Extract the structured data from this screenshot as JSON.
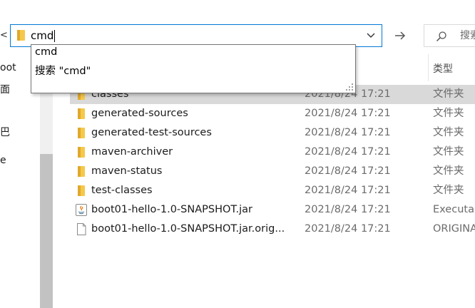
{
  "address_bar": {
    "value": "cmd"
  },
  "search": {
    "placeholder": "搜索"
  },
  "nav_pane": {
    "items": [
      "oot",
      "面",
      "",
      "巴",
      "e"
    ]
  },
  "columns": {
    "type": "类型"
  },
  "autocomplete": {
    "items": [
      "cmd",
      "搜索 \"cmd\""
    ]
  },
  "files": [
    {
      "name": "classes",
      "date": "2021/8/24 17:21",
      "type": "文件夹",
      "icon": "folder-icon",
      "selected": true
    },
    {
      "name": "generated-sources",
      "date": "2021/8/24 17:21",
      "type": "文件夹",
      "icon": "folder-icon"
    },
    {
      "name": "generated-test-sources",
      "date": "2021/8/24 17:21",
      "type": "文件夹",
      "icon": "folder-icon"
    },
    {
      "name": "maven-archiver",
      "date": "2021/8/24 17:21",
      "type": "文件夹",
      "icon": "folder-icon"
    },
    {
      "name": "maven-status",
      "date": "2021/8/24 17:21",
      "type": "文件夹",
      "icon": "folder-icon"
    },
    {
      "name": "test-classes",
      "date": "2021/8/24 17:21",
      "type": "文件夹",
      "icon": "folder-icon"
    },
    {
      "name": "boot01-hello-1.0-SNAPSHOT.jar",
      "date": "2021/8/24 17:21",
      "type": "Executal",
      "icon": "java-jar-icon"
    },
    {
      "name": "boot01-hello-1.0-SNAPSHOT.jar.orig...",
      "date": "2021/8/24 17:21",
      "type": "ORIGINA",
      "icon": "file-icon"
    }
  ],
  "colors": {
    "accent": "#0078d7",
    "folder": "#f5c84c",
    "selected_row": "#d9d9d9"
  }
}
